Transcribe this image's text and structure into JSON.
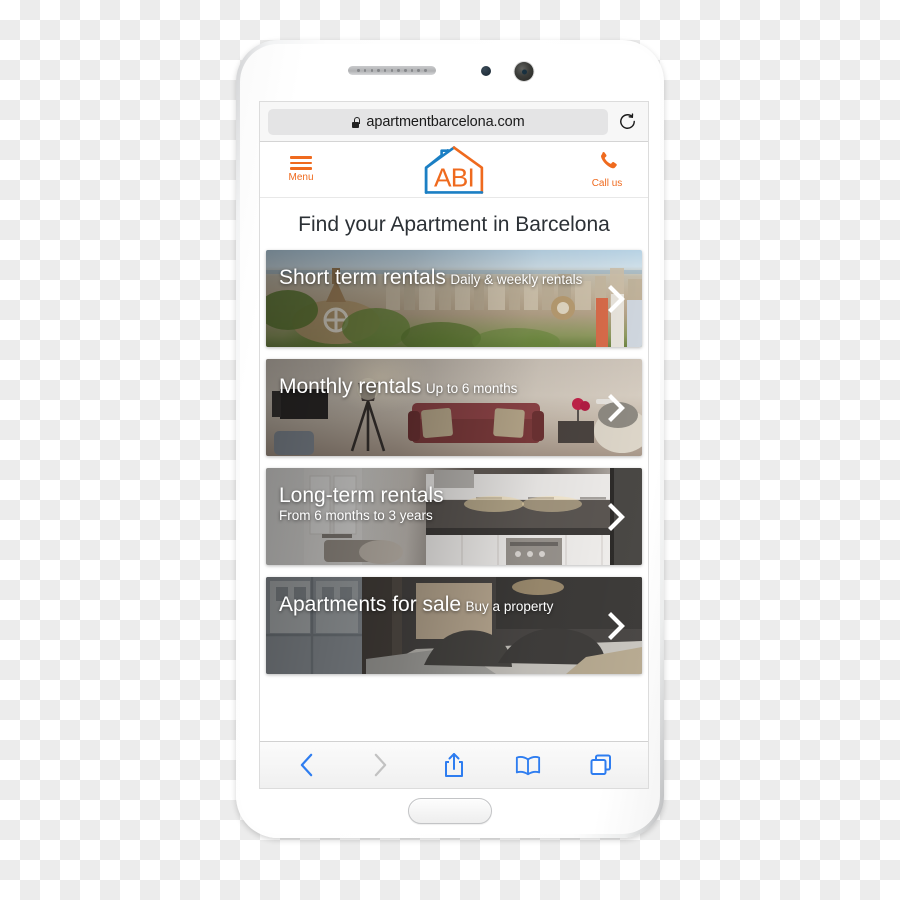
{
  "device": {
    "name": "smartphone-mockup",
    "hardware": {
      "earpiece": "speaker-grille",
      "proximity_sensor": "proximity-sensor",
      "front_camera": "front-camera",
      "home_button": "home-button",
      "volume_button": "volume-button",
      "power_button": "power-button"
    }
  },
  "browser": {
    "url_bar": {
      "lock_icon": "lock-icon",
      "url": "apartmentbarcelona.com",
      "reload_icon": "reload-icon"
    },
    "toolbar": [
      {
        "name": "back",
        "icon": "chevron-left-icon",
        "state": "enabled"
      },
      {
        "name": "forward",
        "icon": "chevron-right-icon",
        "state": "disabled"
      },
      {
        "name": "share",
        "icon": "share-icon",
        "state": "enabled"
      },
      {
        "name": "bookmarks",
        "icon": "book-icon",
        "state": "enabled"
      },
      {
        "name": "tabs",
        "icon": "tabs-icon",
        "state": "enabled"
      }
    ]
  },
  "site": {
    "header": {
      "menu_label": "Menu",
      "menu_icon": "hamburger-icon",
      "logo_text": "ABI",
      "logo_icon": "house-logo-icon",
      "call_label": "Call us",
      "call_icon": "phone-icon"
    },
    "page_title": "Find your Apartment in Barcelona",
    "categories": [
      {
        "title": "Short term rentals",
        "subtitle": "Daily & weekly rentals",
        "photo": "barcelona-cityscape-park-guell",
        "chevron": "chevron-right-icon"
      },
      {
        "title": "Monthly rentals",
        "subtitle": "Up to 6 months",
        "photo": "living-room-red-sofa",
        "chevron": "chevron-right-icon"
      },
      {
        "title": "Long-term rentals",
        "subtitle": "From 6 months to 3 years",
        "photo": "modern-kitchen",
        "chevron": "chevron-right-icon"
      },
      {
        "title": "Apartments for sale",
        "subtitle": "Buy a property",
        "photo": "bedroom-dark-pillows",
        "chevron": "chevron-right-icon"
      }
    ]
  },
  "colors": {
    "brand_orange": "#ef6a1e",
    "brand_blue": "#1b7fc4",
    "toolbar_blue": "#2e7df0",
    "toolbar_disabled": "#c2c2c2",
    "title_text": "#2c3136"
  }
}
